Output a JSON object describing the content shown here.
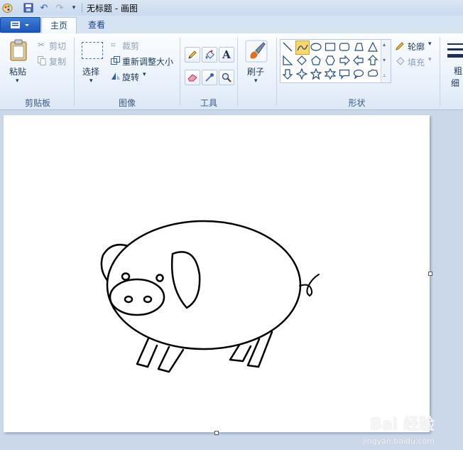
{
  "window": {
    "title": "无标题 - 画图"
  },
  "tabs": [
    {
      "label": "主页"
    },
    {
      "label": "查看"
    }
  ],
  "clipboard": {
    "paste": "粘贴",
    "cut": "剪切",
    "copy": "复制",
    "group": "剪贴板"
  },
  "image": {
    "select": "选择",
    "crop": "裁剪",
    "resize": "重新调整大小",
    "rotate": "旋转",
    "group": "图像"
  },
  "tools": {
    "group": "工具"
  },
  "brushes": {
    "label": "刷子"
  },
  "shapes": {
    "outline": "轮廓",
    "fill": "填充",
    "group": "形状"
  },
  "size": {
    "label_line1": "粗",
    "label_line2": "细"
  },
  "watermark": {
    "brand": "Bai 经验",
    "url": "jingyan.baidu.com"
  },
  "colors": {
    "accent": "#1b56b8",
    "ribbon_bg": "#e8f0fa",
    "canvas_bg": "#ffffff",
    "workspace_bg": "#cbd8ea"
  }
}
